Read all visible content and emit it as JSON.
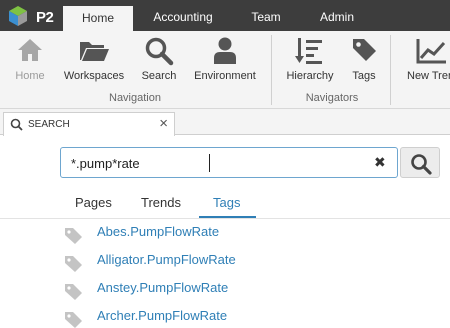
{
  "menubar": {
    "logo_text": "P2",
    "tabs": [
      {
        "label": "Home",
        "active": true
      },
      {
        "label": "Accounting",
        "active": false
      },
      {
        "label": "Team",
        "active": false
      },
      {
        "label": "Admin",
        "active": false
      }
    ]
  },
  "ribbon": {
    "navigation": {
      "group_label": "Navigation",
      "buttons": [
        {
          "label": "Home",
          "icon": "home-icon",
          "disabled": true
        },
        {
          "label": "Workspaces",
          "icon": "folder-icon",
          "disabled": false
        },
        {
          "label": "Search",
          "icon": "search-icon",
          "disabled": false
        },
        {
          "label": "Environment",
          "icon": "person-icon",
          "disabled": false
        }
      ]
    },
    "navigators": {
      "group_label": "Navigators",
      "buttons": [
        {
          "label": "Hierarchy",
          "icon": "hierarchy-icon"
        },
        {
          "label": "Tags",
          "icon": "tag-icon"
        }
      ]
    },
    "trend": {
      "label": "New Tren",
      "icon": "trend-chart-icon"
    }
  },
  "search_tab": {
    "label": "SEARCH",
    "close_glyph": "×",
    "clear_glyph": "✖"
  },
  "search": {
    "value": "*.pump*rate"
  },
  "result_tabs": [
    {
      "label": "Pages",
      "active": false
    },
    {
      "label": "Trends",
      "active": false
    },
    {
      "label": "Tags",
      "active": true
    }
  ],
  "results": [
    {
      "label": "Abes.PumpFlowRate"
    },
    {
      "label": "Alligator.PumpFlowRate"
    },
    {
      "label": "Anstey.PumpFlowRate"
    },
    {
      "label": "Archer.PumpFlowRate"
    }
  ],
  "colors": {
    "accent": "#2f7fb6",
    "menubar": "#3d3d3d",
    "ribbon": "#f4f4f4",
    "icon": "#555555",
    "disabled_icon": "#a6a6a6",
    "result_tag_icon": "#c4c4c4"
  }
}
